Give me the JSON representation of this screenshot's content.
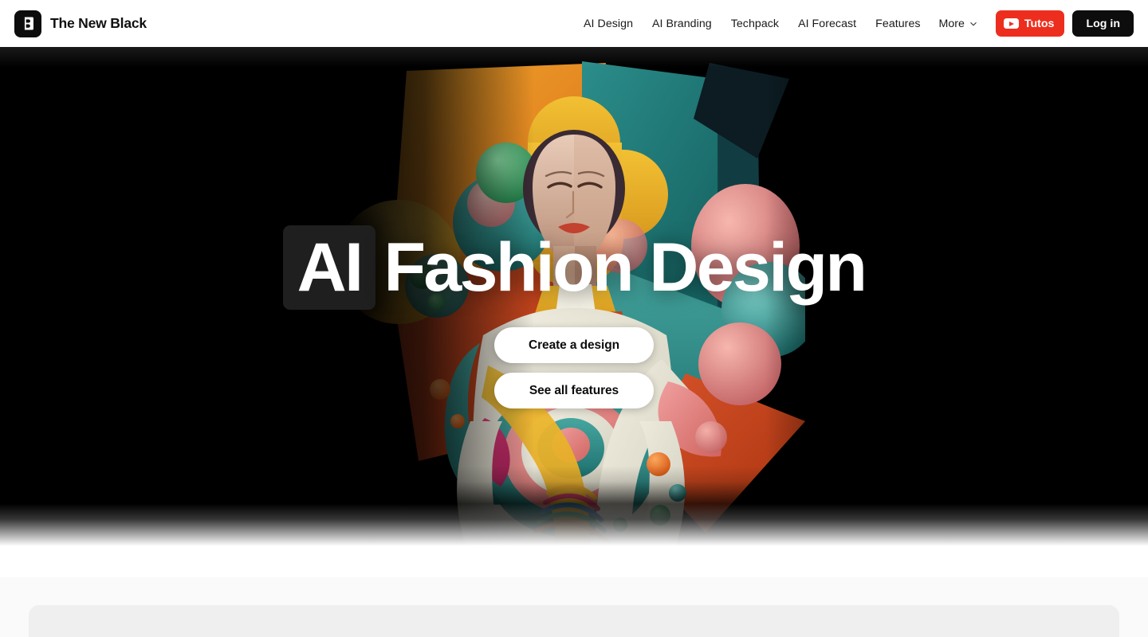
{
  "header": {
    "logo_icon": "the-new-black-logo-icon",
    "brand_name": "The New Black",
    "nav_links": [
      {
        "label": "AI Design"
      },
      {
        "label": "AI Branding"
      },
      {
        "label": "Techpack"
      },
      {
        "label": "AI Forecast"
      },
      {
        "label": "Features"
      }
    ],
    "more": {
      "label": "More",
      "icon": "chevron-down-icon"
    },
    "tutos_button": {
      "label": "Tutos",
      "icon": "youtube-play-icon",
      "color": "#ED2E1E"
    },
    "login_button": {
      "label": "Log in",
      "color": "#0D0D0D"
    }
  },
  "hero": {
    "background_color": "#000000",
    "title_badge": "AI",
    "title_rest": "Fashion Design",
    "image_alt": "AI generated fashion model with colorful abstract 3D geometric shapes",
    "primary_cta": "Create a design",
    "secondary_cta": "See all features"
  },
  "below_section": {
    "panel_color": "#EFEFEF",
    "page_background": "#FAFAFA"
  }
}
